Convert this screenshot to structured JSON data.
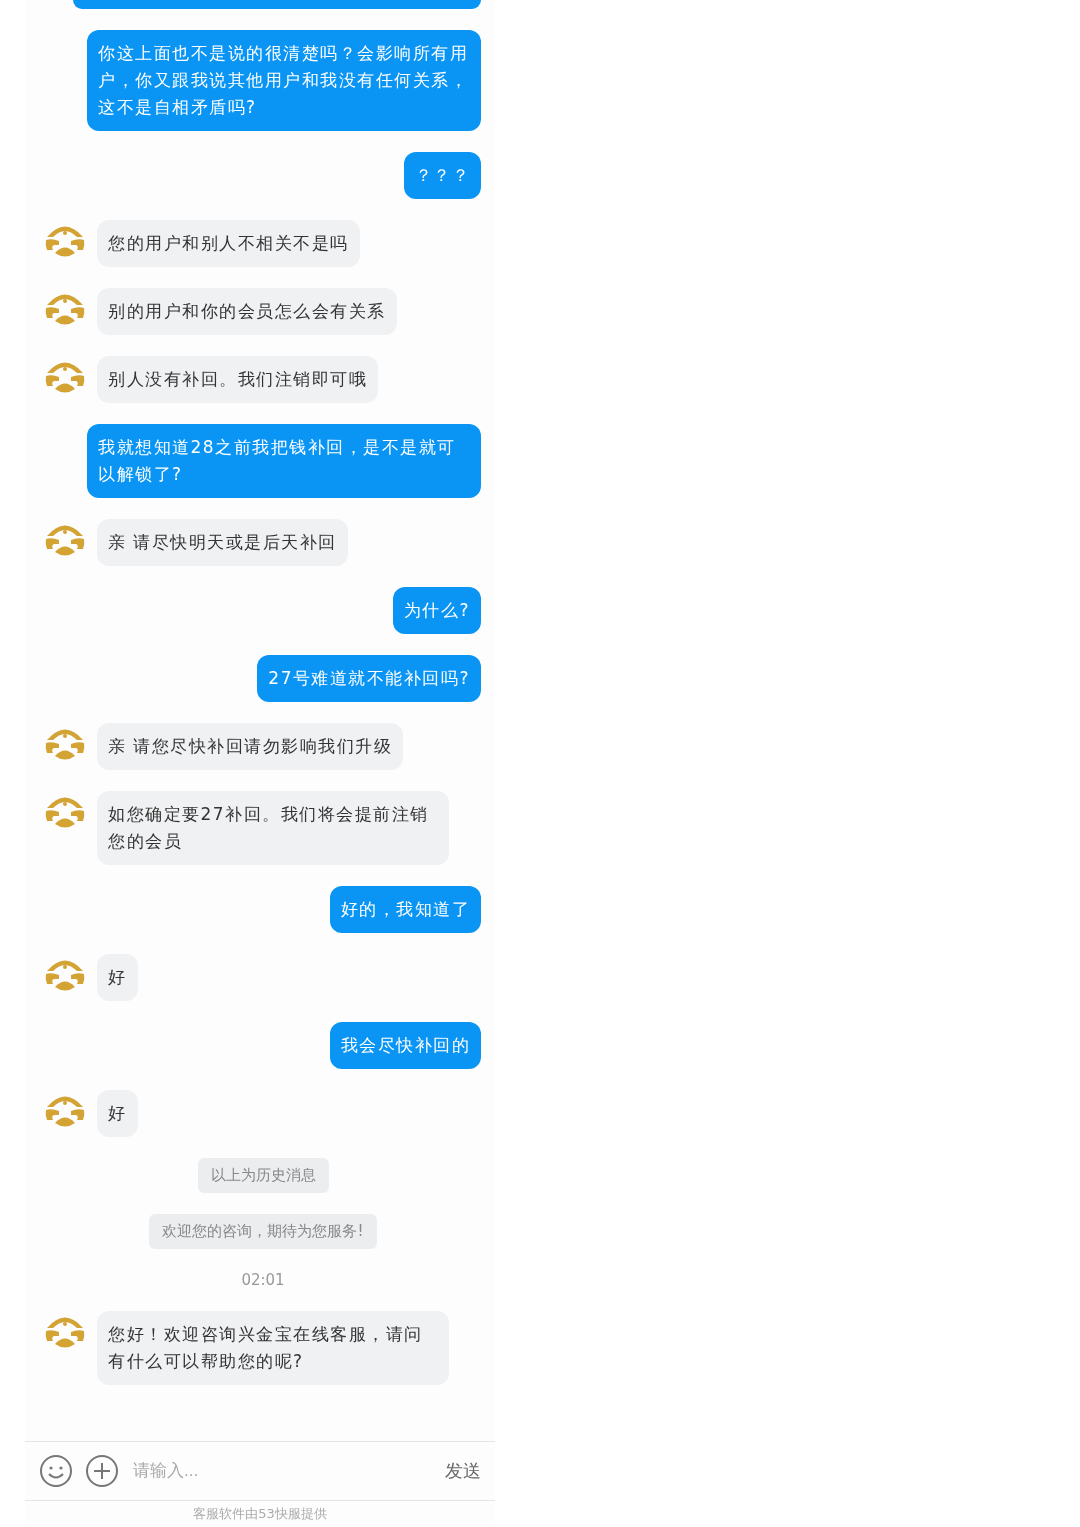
{
  "messages": [
    {
      "kind": "sent_cut"
    },
    {
      "kind": "sent",
      "text": "你这上面也不是说的很清楚吗？会影响所有用户，你又跟我说其他用户和我没有任何关系，这不是自相矛盾吗?"
    },
    {
      "kind": "sent",
      "text": "？？？"
    },
    {
      "kind": "received",
      "text": "您的用户和别人不相关不是吗"
    },
    {
      "kind": "received",
      "text": "别的用户和你的会员怎么会有关系"
    },
    {
      "kind": "received",
      "text": "别人没有补回。我们注销即可哦"
    },
    {
      "kind": "sent",
      "text": "我就想知道28之前我把钱补回，是不是就可以解锁了?"
    },
    {
      "kind": "received",
      "text": "亲 请尽快明天或是后天补回"
    },
    {
      "kind": "sent",
      "text": "为什么?"
    },
    {
      "kind": "sent",
      "text": "27号难道就不能补回吗?"
    },
    {
      "kind": "received",
      "text": "亲 请您尽快补回请勿影响我们升级"
    },
    {
      "kind": "received",
      "text": "如您确定要27补回。我们将会提前注销您的会员"
    },
    {
      "kind": "sent",
      "text": "好的，我知道了"
    },
    {
      "kind": "received",
      "text": "好"
    },
    {
      "kind": "sent",
      "text": "我会尽快补回的"
    },
    {
      "kind": "received",
      "text": "好"
    },
    {
      "kind": "notice",
      "text": "以上为历史消息"
    },
    {
      "kind": "notice",
      "text": "欢迎您的咨询，期待为您服务!"
    },
    {
      "kind": "time",
      "text": "02:01"
    },
    {
      "kind": "received",
      "text": "您好！欢迎咨询兴金宝在线客服，请问有什么可以帮助您的呢?"
    }
  ],
  "composer": {
    "placeholder": "请输入...",
    "send": "发送"
  },
  "footer": "客服软件由53快服提供"
}
